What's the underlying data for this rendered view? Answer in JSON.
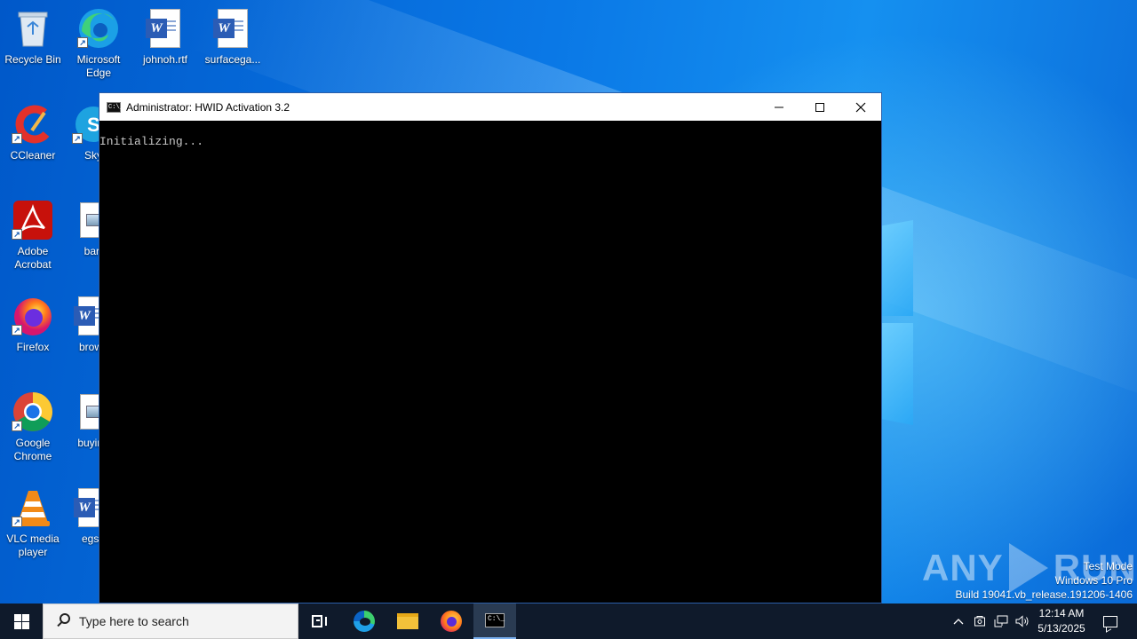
{
  "desktop": {
    "icons": [
      {
        "label": "Recycle Bin",
        "icon": "recycle-bin-icon"
      },
      {
        "label": "Microsoft Edge",
        "icon": "edge-icon"
      },
      {
        "label": "johnoh.rtf",
        "icon": "word-document-icon"
      },
      {
        "label": "surfacega...",
        "icon": "word-document-icon"
      },
      {
        "label": "CCleaner",
        "icon": "ccleaner-icon"
      },
      {
        "label": "Sky",
        "icon": "skype-icon"
      },
      {
        "label": "Adobe Acrobat",
        "icon": "acrobat-icon"
      },
      {
        "label": "bart",
        "icon": "image-file-icon"
      },
      {
        "label": "Firefox",
        "icon": "firefox-icon"
      },
      {
        "label": "brows",
        "icon": "word-document-icon"
      },
      {
        "label": "Google Chrome",
        "icon": "chrome-icon"
      },
      {
        "label": "buying",
        "icon": "image-file-icon"
      },
      {
        "label": "VLC media player",
        "icon": "vlc-icon"
      },
      {
        "label": "egsh",
        "icon": "word-document-icon"
      }
    ]
  },
  "cmd_window": {
    "title": "Administrator:  HWID Activation 3.2",
    "icon_text": "C:\\_",
    "console_text": "Initializing..."
  },
  "watermark": {
    "left": "ANY",
    "right": "RUN"
  },
  "system_info": {
    "line1": "Test Mode",
    "line2": "Windows 10 Pro",
    "line3": "Build 19041.vb_release.191206-1406"
  },
  "taskbar": {
    "search_placeholder": "Type here to search",
    "pinned": [
      "task-view",
      "edge",
      "file-explorer",
      "firefox",
      "command-prompt"
    ],
    "active": "command-prompt",
    "clock_time": "12:14 AM",
    "clock_date": "5/13/2025"
  },
  "colors": {
    "taskbar_bg": "#0f1a2b",
    "desktop_blue": "#0a78e6",
    "console_bg": "#000000",
    "console_text": "#c8c8c8"
  }
}
